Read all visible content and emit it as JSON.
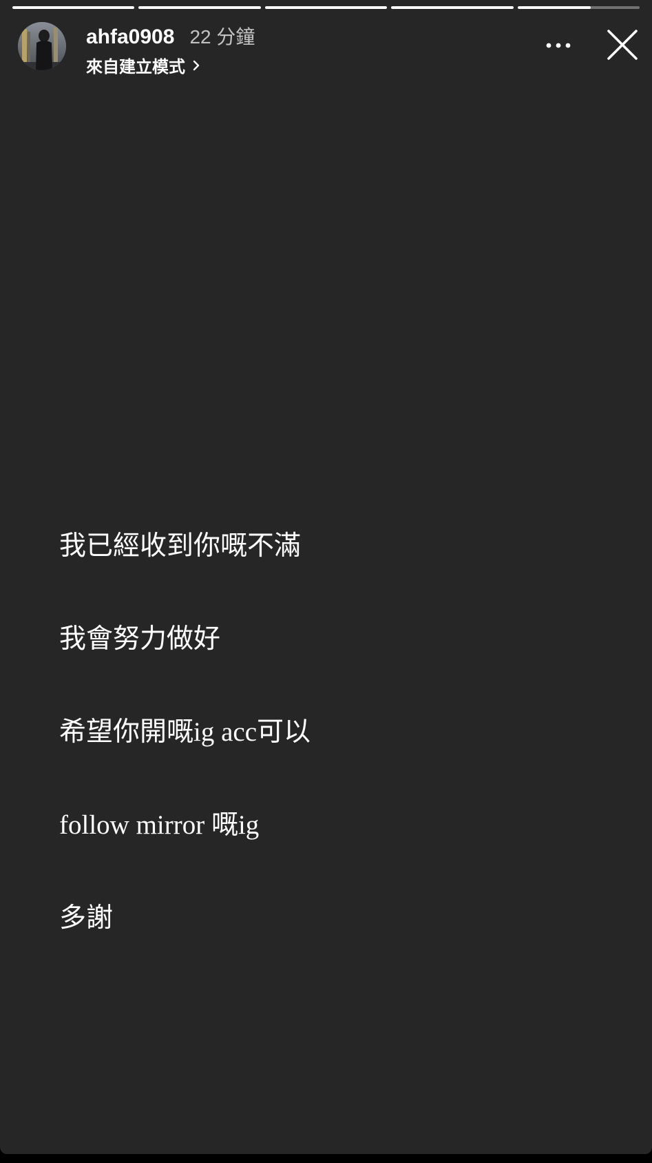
{
  "story": {
    "username": "ahfa0908",
    "timestamp": "22 分鐘",
    "subtitle": "來自建立模式",
    "progress": [
      1,
      1,
      1,
      1,
      0.6
    ],
    "lines": [
      "我已經收到你嘅不滿",
      "我會努力做好",
      "希望你開嘅ig acc可以",
      "follow mirror 嘅ig",
      "多謝"
    ]
  },
  "icons": {
    "avatar": "avatar-photo",
    "chevron": "chevron-right-icon",
    "more": "more-horizontal-icon",
    "close": "close-icon"
  },
  "colors": {
    "background": "#262626",
    "text": "#ffffff",
    "progress_track": "rgba(255,255,255,0.35)",
    "progress_fill": "#ffffff"
  }
}
